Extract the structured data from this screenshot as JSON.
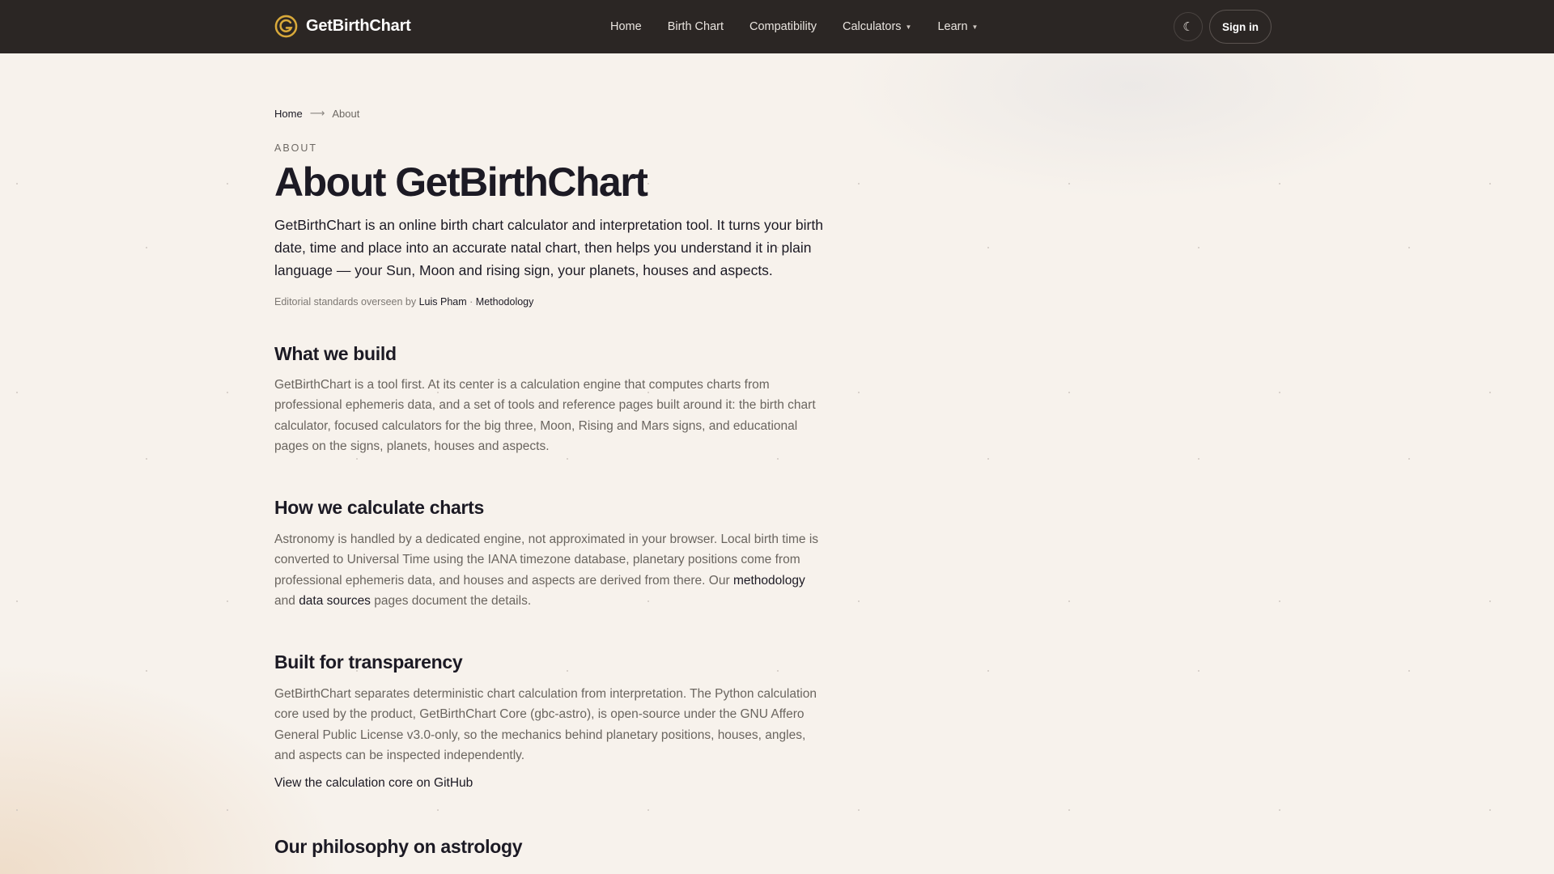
{
  "nav": {
    "brand": "GetBirthChart",
    "links": [
      "Home",
      "Birth Chart",
      "Compatibility",
      "Calculators",
      "Learn"
    ],
    "theme_icon": "moon-icon",
    "signin_label": "Sign in"
  },
  "breadcrumb": {
    "home": "Home",
    "current": "About"
  },
  "header": {
    "eyebrow": "ABOUT",
    "title": "About GetBirthChart",
    "lead": "GetBirthChart is an online birth chart calculator and interpretation tool. It turns your birth date, time and place into an accurate natal chart, then helps you understand it in plain language — your Sun, Moon and rising sign, your planets, houses and aspects.",
    "byline_prefix": "Editorial standards overseen by",
    "byline_author": "Luis Pham",
    "byline_sep": "·",
    "byline_methodology": "Methodology"
  },
  "sections": [
    {
      "heading": "What we build",
      "body": "GetBirthChart is a tool first. At its center is a calculation engine that computes charts from professional ephemeris data, and a set of tools and reference pages built around it: the birth chart calculator, focused calculators for the big three, Moon, Rising and Mars signs, and educational pages on the signs, planets, houses and aspects."
    },
    {
      "heading": "How we calculate charts",
      "body_a": "Astronomy is handled by a dedicated engine, not approximated in your browser. Local birth time is converted to Universal Time using the IANA timezone database, planetary positions come from professional ephemeris data, and houses and aspects are derived from there. Our",
      "link_methodology": "methodology",
      "body_b": "and",
      "link_data_sources": "data sources",
      "body_c": "pages document the details."
    },
    {
      "heading": "Built for transparency",
      "body": "GetBirthChart separates deterministic chart calculation from interpretation. The Python calculation core used by the product, GetBirthChart Core (gbc-astro), is open-source under the GNU Affero General Public License v3.0-only, so the mechanics behind planetary positions, houses, angles, and aspects can be inspected independently.",
      "link": "View the calculation core on GitHub"
    },
    {
      "heading": "Our philosophy on astrology"
    }
  ],
  "colors": {
    "nav_bg": "#2b2624",
    "page_bg": "#f7f2ec",
    "logo_gold": "#d9a93a"
  }
}
